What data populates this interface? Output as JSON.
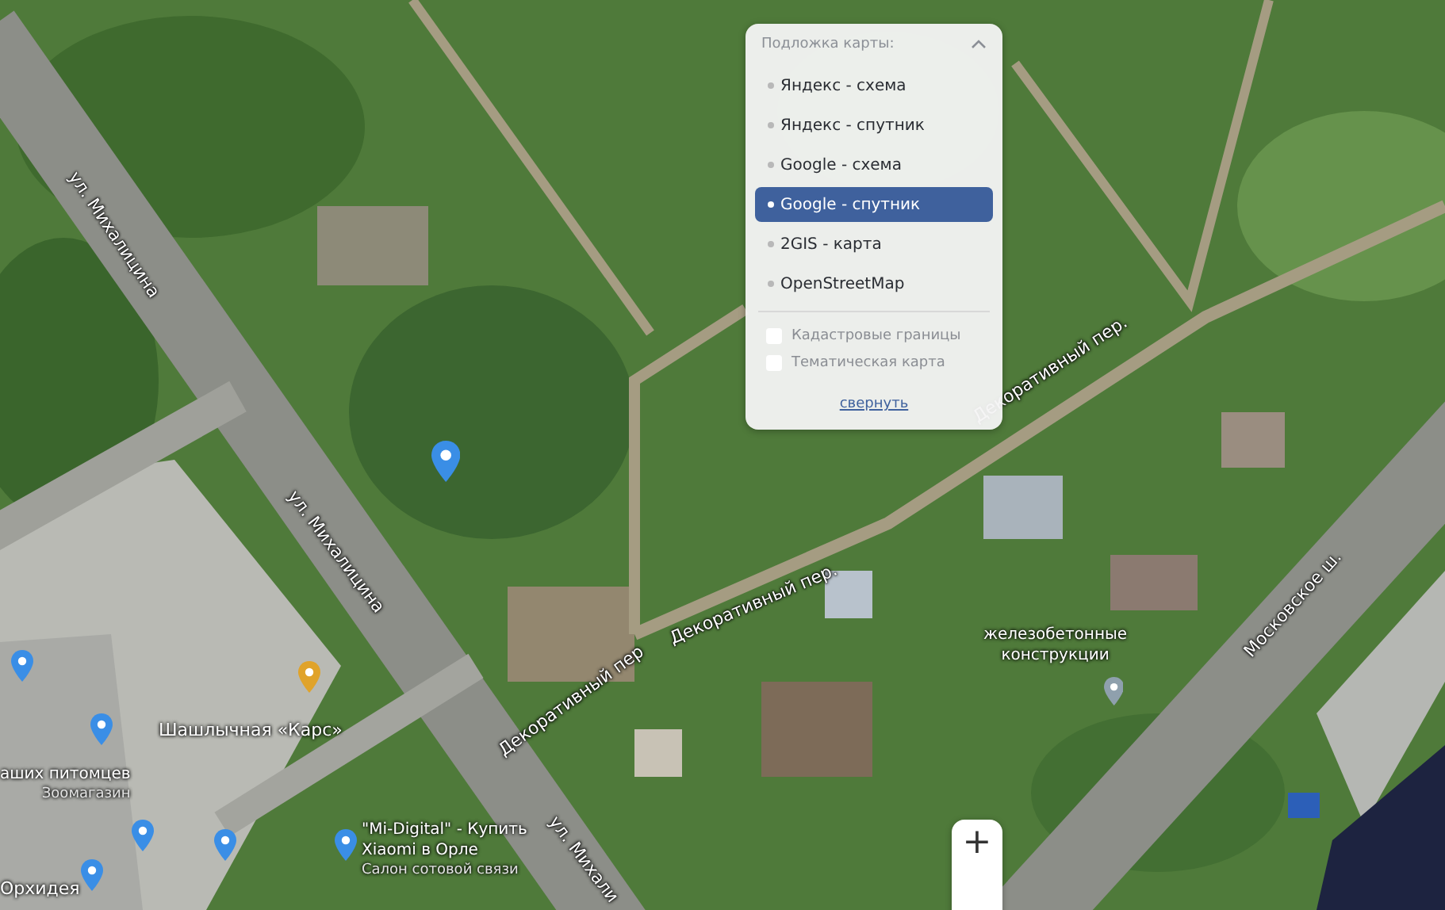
{
  "map": {
    "street_labels": [
      {
        "text": "ул. Михалицина"
      },
      {
        "text": "ул. Михалицина"
      },
      {
        "text": "ул. Михали"
      },
      {
        "text": "Декоративный пер."
      },
      {
        "text": "Декоративный пер."
      },
      {
        "text": "Декоративный пер"
      },
      {
        "text": "Московское ш."
      }
    ],
    "place_labels": [
      {
        "kind": "plain",
        "lines": [
          "железобетонные",
          "конструкции"
        ]
      },
      {
        "kind": "title",
        "lines": [
          "Шашлычная «Карс»"
        ]
      },
      {
        "kind": "subtitled",
        "lines": [
          "аших питомцев",
          "Зоомагазин"
        ]
      },
      {
        "kind": "subtitled",
        "lines": [
          "\"Mi-Digital\" - Купить",
          "Xiaomi в Орле",
          "Салон сотовой связи"
        ]
      },
      {
        "kind": "title",
        "lines": [
          "Орхидея"
        ]
      }
    ]
  },
  "layer_panel": {
    "title": "Подложка карты:",
    "expanded": true,
    "layers": [
      {
        "label": "Яндекс - схема",
        "selected": false
      },
      {
        "label": "Яндекс - спутник",
        "selected": false
      },
      {
        "label": "Google - схема",
        "selected": false
      },
      {
        "label": "Google - спутник",
        "selected": true
      },
      {
        "label": "2GIS - карта",
        "selected": false
      },
      {
        "label": "OpenStreetMap",
        "selected": false
      }
    ],
    "overlays": [
      {
        "label": "Кадастровые границы",
        "checked": false
      },
      {
        "label": "Тематическая карта",
        "checked": false
      }
    ],
    "collapse_link": "свернуть"
  },
  "zoom_in": "+"
}
